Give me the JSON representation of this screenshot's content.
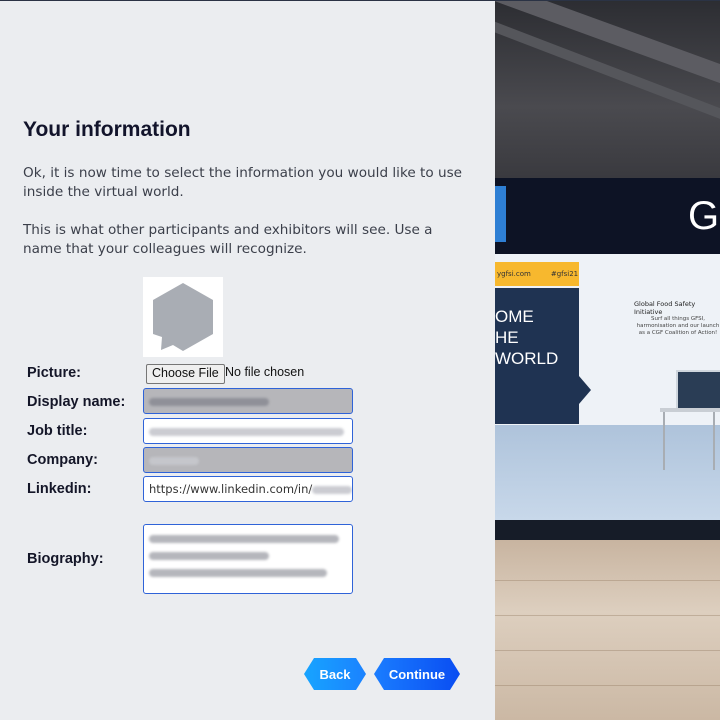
{
  "form": {
    "title": "Your information",
    "intro1": "Ok, it is now time to select the information you would like to use inside the virtual world.",
    "intro2": "This is what other participants and exhibitors will see. Use a name that your colleagues will recognize.",
    "labels": {
      "picture": "Picture:",
      "display_name": "Display name:",
      "job_title": "Job title:",
      "company": "Company:",
      "linkedin": "Linkedin:",
      "biography": "Biography:"
    },
    "file_button": "Choose File",
    "file_status": "No file chosen",
    "linkedin_value": "https://www.linkedin.com/in/",
    "back": "Back",
    "continue": "Continue"
  },
  "scene": {
    "sign_text": "G",
    "banner_url": "ygfsi.com",
    "banner_tag": "#gfsi21",
    "welcome_lines": [
      "OME",
      "HE",
      "WORLD"
    ],
    "booth_heading": "Global Food Safety Initiative",
    "booth_text": "Surf all things GFSI, harmonisation and our launch as a CGF Coalition of Action!"
  },
  "colors": {
    "panel_bg": "#ebedf0",
    "field_border": "#2f63d8",
    "back_button": "#17a4ff",
    "continue_button": "#0a4df2"
  }
}
